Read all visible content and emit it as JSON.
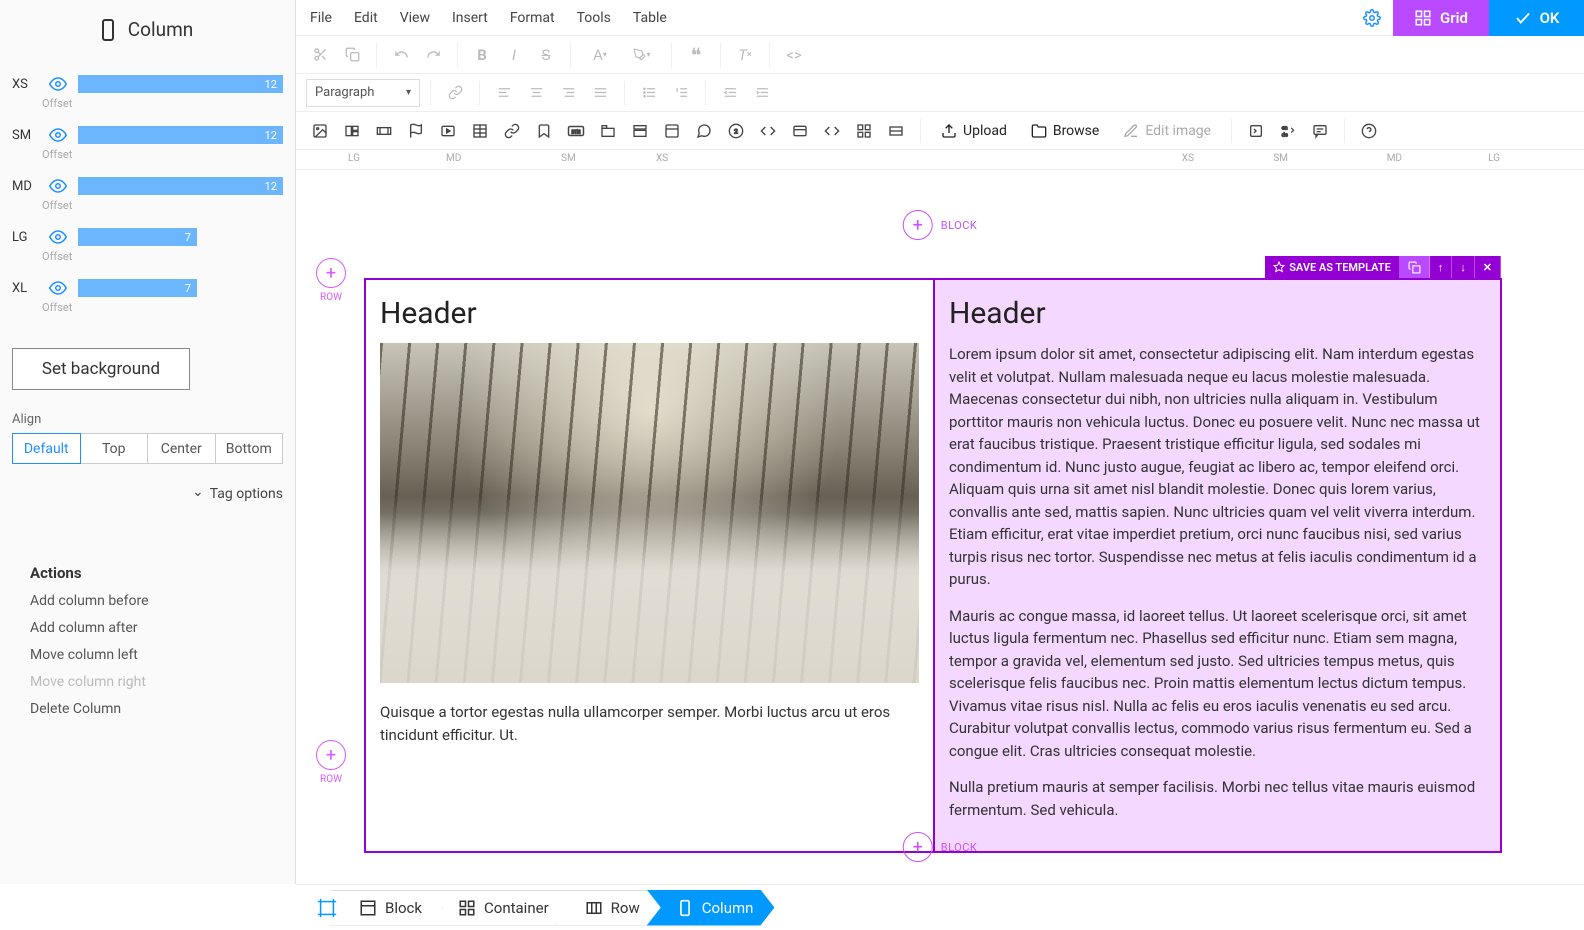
{
  "sidebar": {
    "title": "Column",
    "breakpoints": [
      {
        "label": "XS",
        "value": "12",
        "offset": "Offset",
        "full": true
      },
      {
        "label": "SM",
        "value": "12",
        "offset": "Offset",
        "full": true
      },
      {
        "label": "MD",
        "value": "12",
        "offset": "Offset",
        "full": true
      },
      {
        "label": "LG",
        "value": "7",
        "offset": "Offset",
        "full": false
      },
      {
        "label": "XL",
        "value": "7",
        "offset": "Offset",
        "full": false
      }
    ],
    "set_background": "Set background",
    "align_label": "Align",
    "align_options": [
      "Default",
      "Top",
      "Center",
      "Bottom"
    ],
    "tag_options": "Tag options",
    "actions_title": "Actions",
    "actions": [
      {
        "label": "Add column before",
        "disabled": false
      },
      {
        "label": "Add column after",
        "disabled": false
      },
      {
        "label": "Move column left",
        "disabled": false
      },
      {
        "label": "Move column right",
        "disabled": true
      },
      {
        "label": "Delete Column",
        "disabled": false
      }
    ]
  },
  "menu": [
    "File",
    "Edit",
    "View",
    "Insert",
    "Format",
    "Tools",
    "Table"
  ],
  "topbar": {
    "grid": "Grid",
    "ok": "OK"
  },
  "toolbar2": {
    "paragraph": "Paragraph"
  },
  "toolbar3": {
    "upload": "Upload",
    "browse": "Browse",
    "edit_image": "Edit image"
  },
  "ruler": {
    "left": [
      "LG",
      "MD",
      "SM",
      "XS"
    ],
    "right": [
      "XS",
      "SM",
      "MD",
      "LG"
    ]
  },
  "canvas": {
    "block_label": "BLOCK",
    "row_label": "ROW",
    "save_template": "SAVE AS TEMPLATE",
    "col1": {
      "header": "Header",
      "text": "Quisque a tortor egestas nulla ullamcorper semper. Morbi luctus arcu ut eros tincidunt efficitur. Ut."
    },
    "col2": {
      "header": "Header",
      "p1": "Lorem ipsum dolor sit amet, consectetur adipiscing elit. Nam interdum egestas velit et volutpat. Nullam malesuada neque eu lacus molestie malesuada. Maecenas consectetur dui nibh, non ultricies nulla aliquam in. Vestibulum porttitor mauris non vehicula luctus. Donec eu posuere velit. Nunc nec massa ut erat faucibus tristique. Praesent tristique efficitur ligula, sed sodales mi condimentum id. Nunc justo augue, feugiat ac libero ac, tempor eleifend orci. Aliquam quis urna sit amet nisl blandit molestie. Donec quis lorem varius, convallis ante sed, mattis sapien. Nunc ultricies quam vel velit viverra interdum. Etiam efficitur, erat vitae imperdiet pretium, orci nunc faucibus nisi, sed varius turpis risus nec tortor. Suspendisse nec metus at felis iaculis condimentum id a purus.",
      "p2": "Mauris ac congue massa, id laoreet tellus. Ut laoreet scelerisque orci, sit amet luctus ligula fermentum nec. Phasellus sed efficitur nunc. Etiam sem magna, tempor a gravida vel, elementum sed justo. Sed ultricies tempus metus, quis scelerisque felis faucibus nec. Proin mattis elementum lectus dictum tempus. Vivamus vitae risus nisl. Nulla ac felis eu eros iaculis venenatis eu sed arcu. Curabitur volutpat convallis lectus, commodo varius risus fermentum eu. Sed a congue elit. Cras ultricies consequat molestie.",
      "p3": "Nulla pretium mauris at semper facilisis. Morbi nec tellus vitae mauris euismod fermentum. Sed vehicula."
    }
  },
  "breadcrumb": [
    "Block",
    "Container",
    "Row",
    "Column"
  ]
}
